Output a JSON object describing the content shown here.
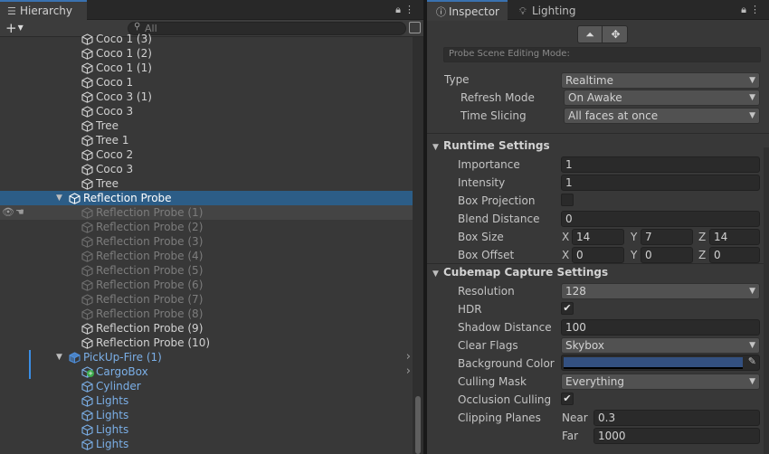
{
  "hierarchy": {
    "tab_label": "Hierarchy",
    "search_placeholder": "All",
    "rows": [
      {
        "label": "Coco 1 (3)",
        "style": "normal"
      },
      {
        "label": "Coco 1 (2)",
        "style": "normal"
      },
      {
        "label": "Coco 1 (1)",
        "style": "normal"
      },
      {
        "label": "Coco 1",
        "style": "normal"
      },
      {
        "label": "Coco 3 (1)",
        "style": "normal"
      },
      {
        "label": "Coco 3",
        "style": "normal"
      },
      {
        "label": "Tree",
        "style": "normal"
      },
      {
        "label": "Tree  1",
        "style": "normal"
      },
      {
        "label": "Coco 2",
        "style": "normal"
      },
      {
        "label": "Coco 3",
        "style": "normal"
      },
      {
        "label": "Tree",
        "style": "normal"
      },
      {
        "label": "Reflection Probe",
        "style": "selected"
      },
      {
        "label": "Reflection Probe (1)",
        "style": "dim"
      },
      {
        "label": "Reflection Probe (2)",
        "style": "dim"
      },
      {
        "label": "Reflection Probe (3)",
        "style": "dim"
      },
      {
        "label": "Reflection Probe (4)",
        "style": "dim"
      },
      {
        "label": "Reflection Probe (5)",
        "style": "dim"
      },
      {
        "label": "Reflection Probe (6)",
        "style": "dim"
      },
      {
        "label": "Reflection Probe (7)",
        "style": "dim"
      },
      {
        "label": "Reflection Probe (8)",
        "style": "dim"
      },
      {
        "label": "Reflection Probe (9)",
        "style": "normal"
      },
      {
        "label": "Reflection Probe (10)",
        "style": "normal"
      },
      {
        "label": "PickUp-Fire (1)",
        "style": "prefab"
      },
      {
        "label": "CargoBox",
        "style": "prefab"
      },
      {
        "label": "Cylinder",
        "style": "prefab"
      },
      {
        "label": "Lights",
        "style": "prefab"
      },
      {
        "label": "Lights",
        "style": "prefab"
      },
      {
        "label": "Lights",
        "style": "prefab"
      },
      {
        "label": "Lights",
        "style": "prefab"
      }
    ]
  },
  "inspector": {
    "tab_label": "Inspector",
    "lighting_tab_label": "Lighting",
    "mode_label": "Probe Scene Editing Mode:",
    "type_label": "Type",
    "type_value": "Realtime",
    "refresh_mode_label": "Refresh Mode",
    "refresh_mode_value": "On Awake",
    "time_slicing_label": "Time Slicing",
    "time_slicing_value": "All faces at once",
    "runtime_section": "Runtime Settings",
    "importance_label": "Importance",
    "importance_value": "1",
    "intensity_label": "Intensity",
    "intensity_value": "1",
    "box_projection_label": "Box Projection",
    "blend_distance_label": "Blend Distance",
    "blend_distance_value": "0",
    "box_size_label": "Box Size",
    "box_size": {
      "x": "14",
      "y": "7",
      "z": "14"
    },
    "box_offset_label": "Box Offset",
    "box_offset": {
      "x": "0",
      "y": "0",
      "z": "0"
    },
    "axis_x": "X",
    "axis_y": "Y",
    "axis_z": "Z",
    "cubemap_section": "Cubemap Capture Settings",
    "resolution_label": "Resolution",
    "resolution_value": "128",
    "hdr_label": "HDR",
    "shadow_distance_label": "Shadow Distance",
    "shadow_distance_value": "100",
    "clear_flags_label": "Clear Flags",
    "clear_flags_value": "Skybox",
    "background_color_label": "Background Color",
    "background_color": "#335080",
    "culling_mask_label": "Culling Mask",
    "culling_mask_value": "Everything",
    "occlusion_culling_label": "Occlusion Culling",
    "clipping_planes_label": "Clipping Planes",
    "near_label": "Near",
    "near_value": "0.3",
    "far_label": "Far",
    "far_value": "1000"
  }
}
